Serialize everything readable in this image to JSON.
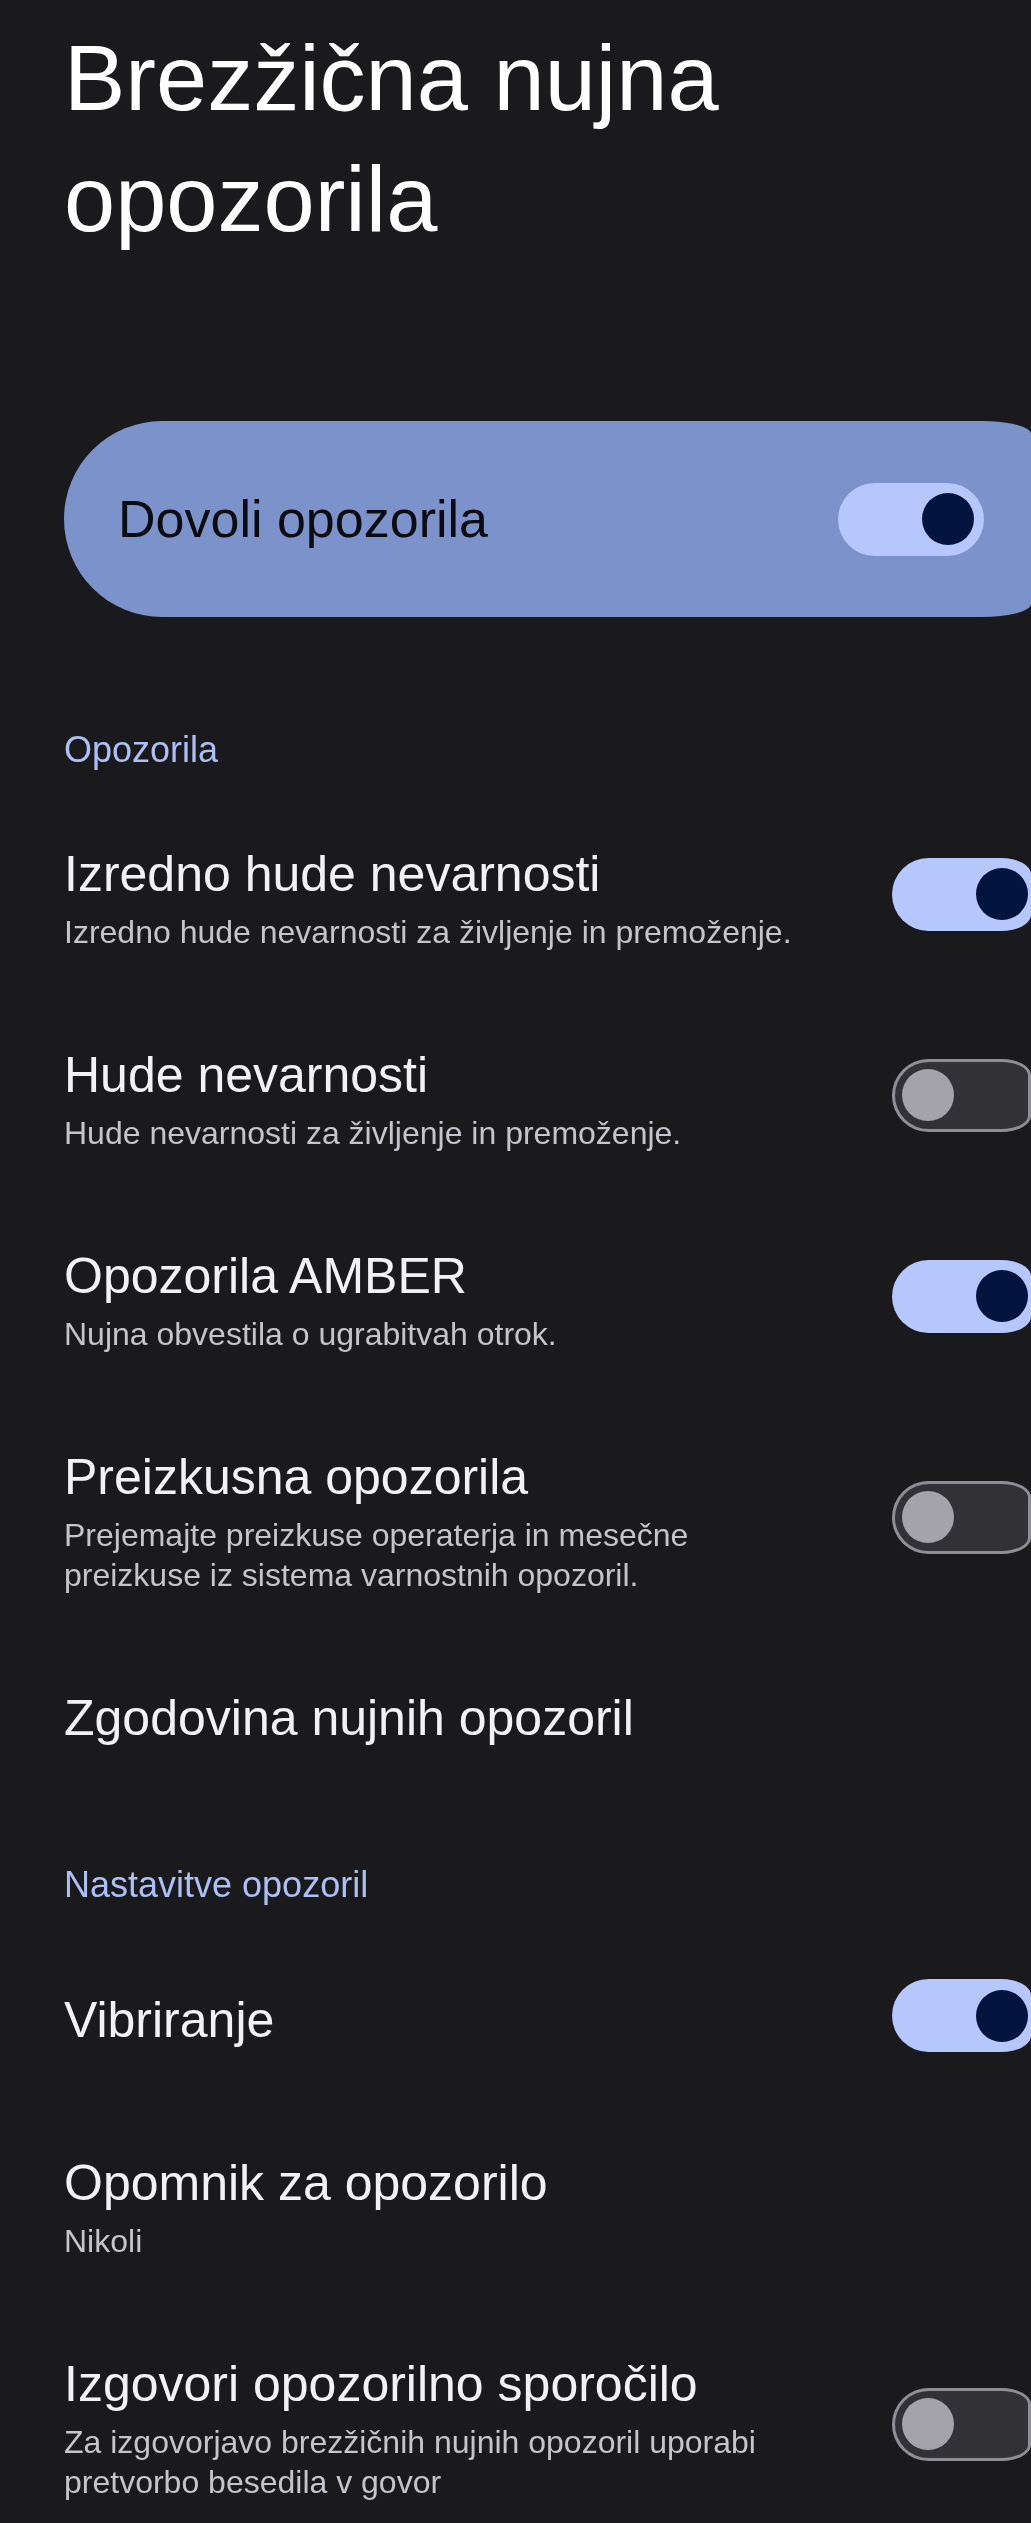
{
  "header": {
    "title": "Brezžična nujna opozorila"
  },
  "master_switch": {
    "label": "Dovoli opozorila",
    "on": true
  },
  "sections": [
    {
      "header": "Opozorila",
      "items": [
        {
          "kind": "switch",
          "title": "Izredno hude nevarnosti",
          "summary": "Izredno hude nevarnosti za življenje in premoženje.",
          "on": true
        },
        {
          "kind": "switch",
          "title": "Hude nevarnosti",
          "summary": "Hude nevarnosti za življenje in premoženje.",
          "on": false
        },
        {
          "kind": "switch",
          "title": "Opozorila AMBER",
          "summary": "Nujna obvestila o ugrabitvah otrok.",
          "on": true
        },
        {
          "kind": "switch",
          "title": "Preizkusna opozorila",
          "summary": "Prejemajte preizkuse operaterja in mesečne preizkuse iz sistema varnostnih opozoril.",
          "on": false
        },
        {
          "kind": "link",
          "title": "Zgodovina nujnih opozoril"
        }
      ]
    },
    {
      "header": "Nastavitve opozoril",
      "items": [
        {
          "kind": "switch",
          "title": "Vibriranje",
          "on": true
        },
        {
          "kind": "link",
          "title": "Opomnik za opozorilo",
          "summary": "Nikoli"
        },
        {
          "kind": "switch",
          "title": "Izgovori opozorilno sporočilo",
          "summary": "Za izgovorjavo brezžičnih nujnih opozoril uporabi pretvorbo besedila v govor",
          "on": false
        }
      ]
    }
  ]
}
